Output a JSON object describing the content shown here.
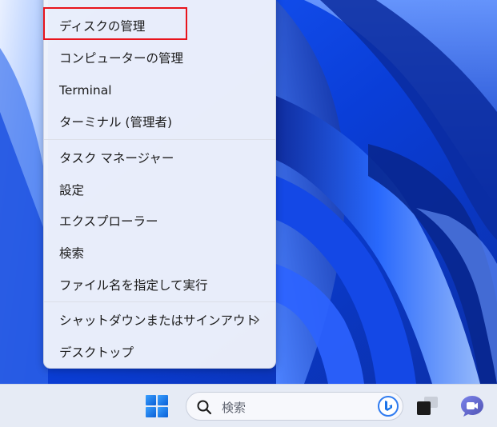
{
  "context_menu": {
    "items": [
      {
        "label": "ディスクの管理"
      },
      {
        "label": "コンピューターの管理"
      },
      {
        "label": "Terminal"
      },
      {
        "label": "ターミナル (管理者)"
      },
      {
        "label": "タスク マネージャー"
      },
      {
        "label": "設定"
      },
      {
        "label": "エクスプローラー"
      },
      {
        "label": "検索"
      },
      {
        "label": "ファイル名を指定して実行"
      },
      {
        "label": "シャットダウンまたはサインアウト"
      },
      {
        "label": "デスクトップ"
      }
    ],
    "highlight_color": "#e8141c"
  },
  "taskbar": {
    "search_placeholder": "検索",
    "icons": [
      "windows-start-icon",
      "search-icon",
      "bing-icon",
      "task-view-icon",
      "chat-icon"
    ]
  },
  "colors": {
    "wallpaper_primary": "#0a3ed8",
    "wallpaper_light": "#7aa8ff",
    "menu_background": "#f0f3fb",
    "taskbar_background": "#e6ebf5",
    "start_blue": "#1a73e8"
  }
}
